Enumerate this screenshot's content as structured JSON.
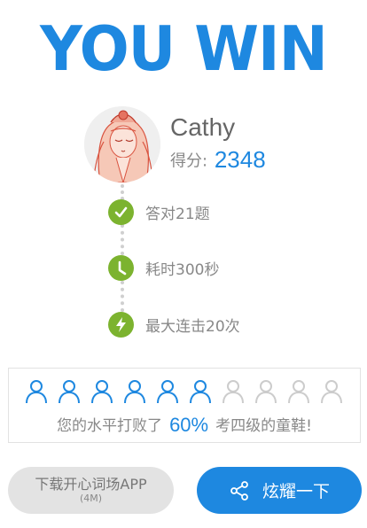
{
  "header": {
    "title": "YOU WIN"
  },
  "player": {
    "name": "Cathy",
    "score_label": "得分:",
    "score": "2348"
  },
  "stats": [
    {
      "icon": "check-icon",
      "text": "答对21题"
    },
    {
      "icon": "clock-icon",
      "text": "耗时300秒"
    },
    {
      "icon": "lightning-icon",
      "text": "最大连击20次"
    }
  ],
  "rank": {
    "filled_people": 6,
    "total_people": 10,
    "prefix": "您的水平打败了",
    "percent": "60%",
    "suffix": "考四级的童鞋!"
  },
  "buttons": {
    "download_label": "下载开心词场APP",
    "download_size": "(4M)",
    "share_label": "炫耀一下"
  },
  "colors": {
    "accent": "#1e88e0",
    "success": "#7cb32f",
    "muted": "#cccccc"
  }
}
